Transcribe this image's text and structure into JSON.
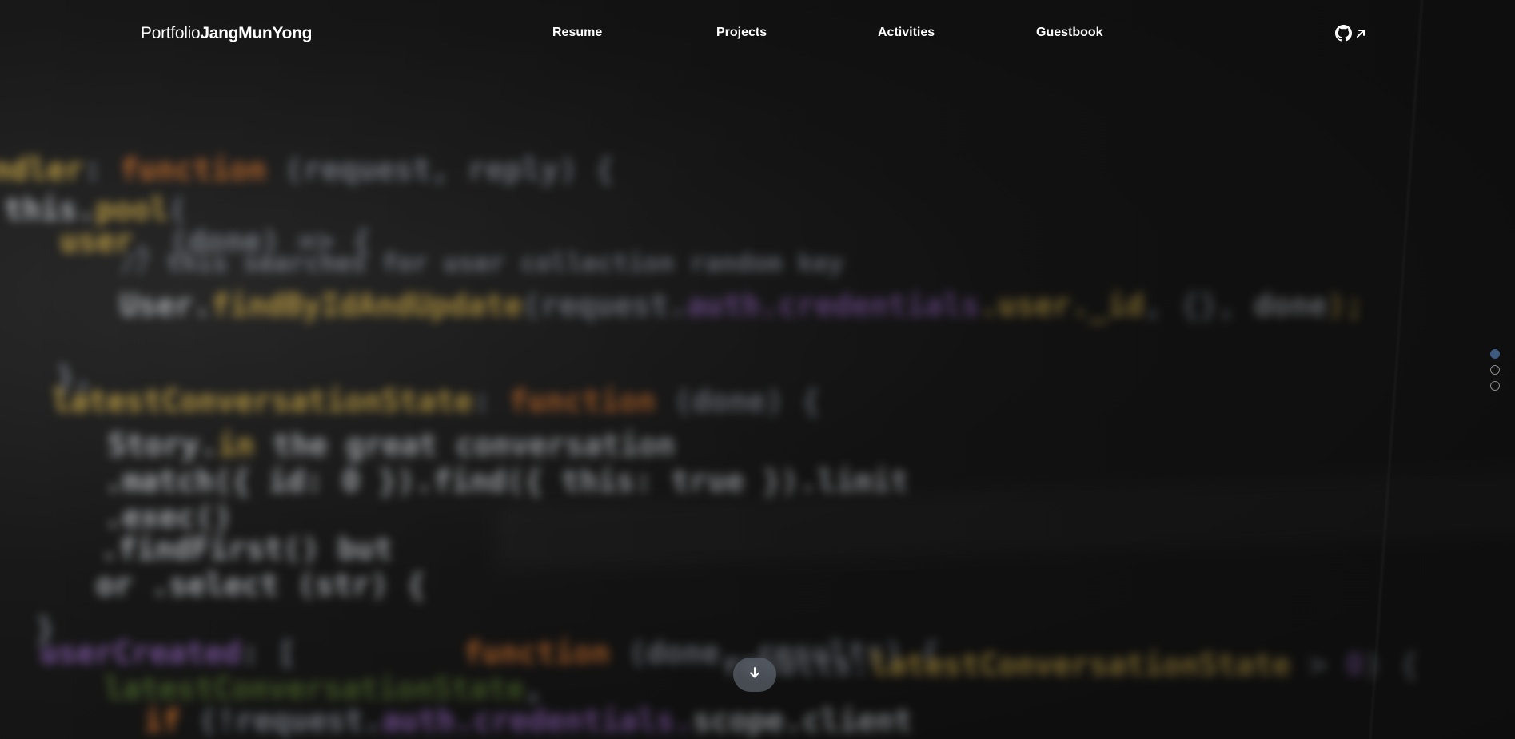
{
  "nav": {
    "logo_light": "Portfolio",
    "logo_bold": "JangMunYong",
    "links": [
      "Resume",
      "Projects",
      "Activities",
      "Guestbook"
    ],
    "github_icon": "github-icon",
    "external_icon": "arrow-up-right-icon"
  },
  "section_indicator": {
    "count": 3,
    "active_index": 0,
    "active_color": "#3d5a80"
  },
  "scroll_button": {
    "icon": "arrow-down-icon"
  },
  "background": {
    "description_icon": "blurred-code-background"
  }
}
